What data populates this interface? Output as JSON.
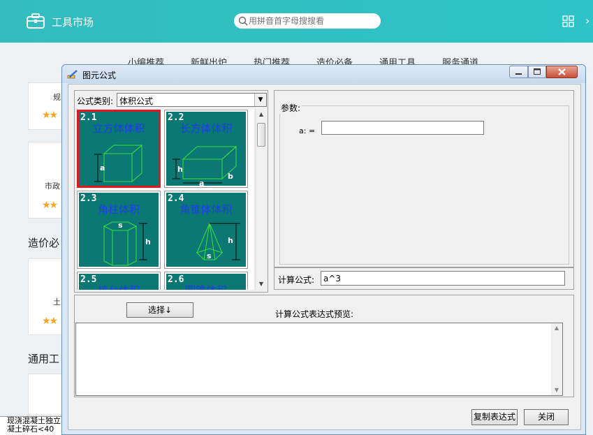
{
  "app": {
    "title": "工具市场",
    "search_placeholder": "用拼音首字母搜搜看",
    "tabs": [
      "小编推荐",
      "新鲜出炉",
      "热门推荐",
      "造价必备",
      "通用工具",
      "服务通道"
    ],
    "card_labels": [
      "规",
      "市政",
      "土"
    ],
    "sections": [
      "造价必",
      "通用工"
    ],
    "status_lines": [
      "现浇混凝土独立",
      "凝土碎石<40"
    ]
  },
  "dialog": {
    "title": "图元公式",
    "category_label": "公式类别:",
    "category_value": "体积公式",
    "thumbnails": [
      {
        "num": "2.1",
        "name": "立方体体积",
        "selected": true
      },
      {
        "num": "2.2",
        "name": "长方体体积",
        "selected": false
      },
      {
        "num": "2.3",
        "name": "角柱体积",
        "selected": false
      },
      {
        "num": "2.4",
        "name": "角锥体体积",
        "selected": false
      },
      {
        "num": "2.5",
        "name": "棱台体积",
        "selected": false
      },
      {
        "num": "2.6",
        "name": "圆锥体积",
        "selected": false
      }
    ],
    "params_label": "参数:",
    "param_a_label": "a: =",
    "param_a_value": "",
    "formula_label": "计算公式:",
    "formula_value": "a^3",
    "select_button": "选择↓",
    "preview_label": "计算公式表达式预览:",
    "copy_button": "复制表达式",
    "close_button": "关闭"
  }
}
